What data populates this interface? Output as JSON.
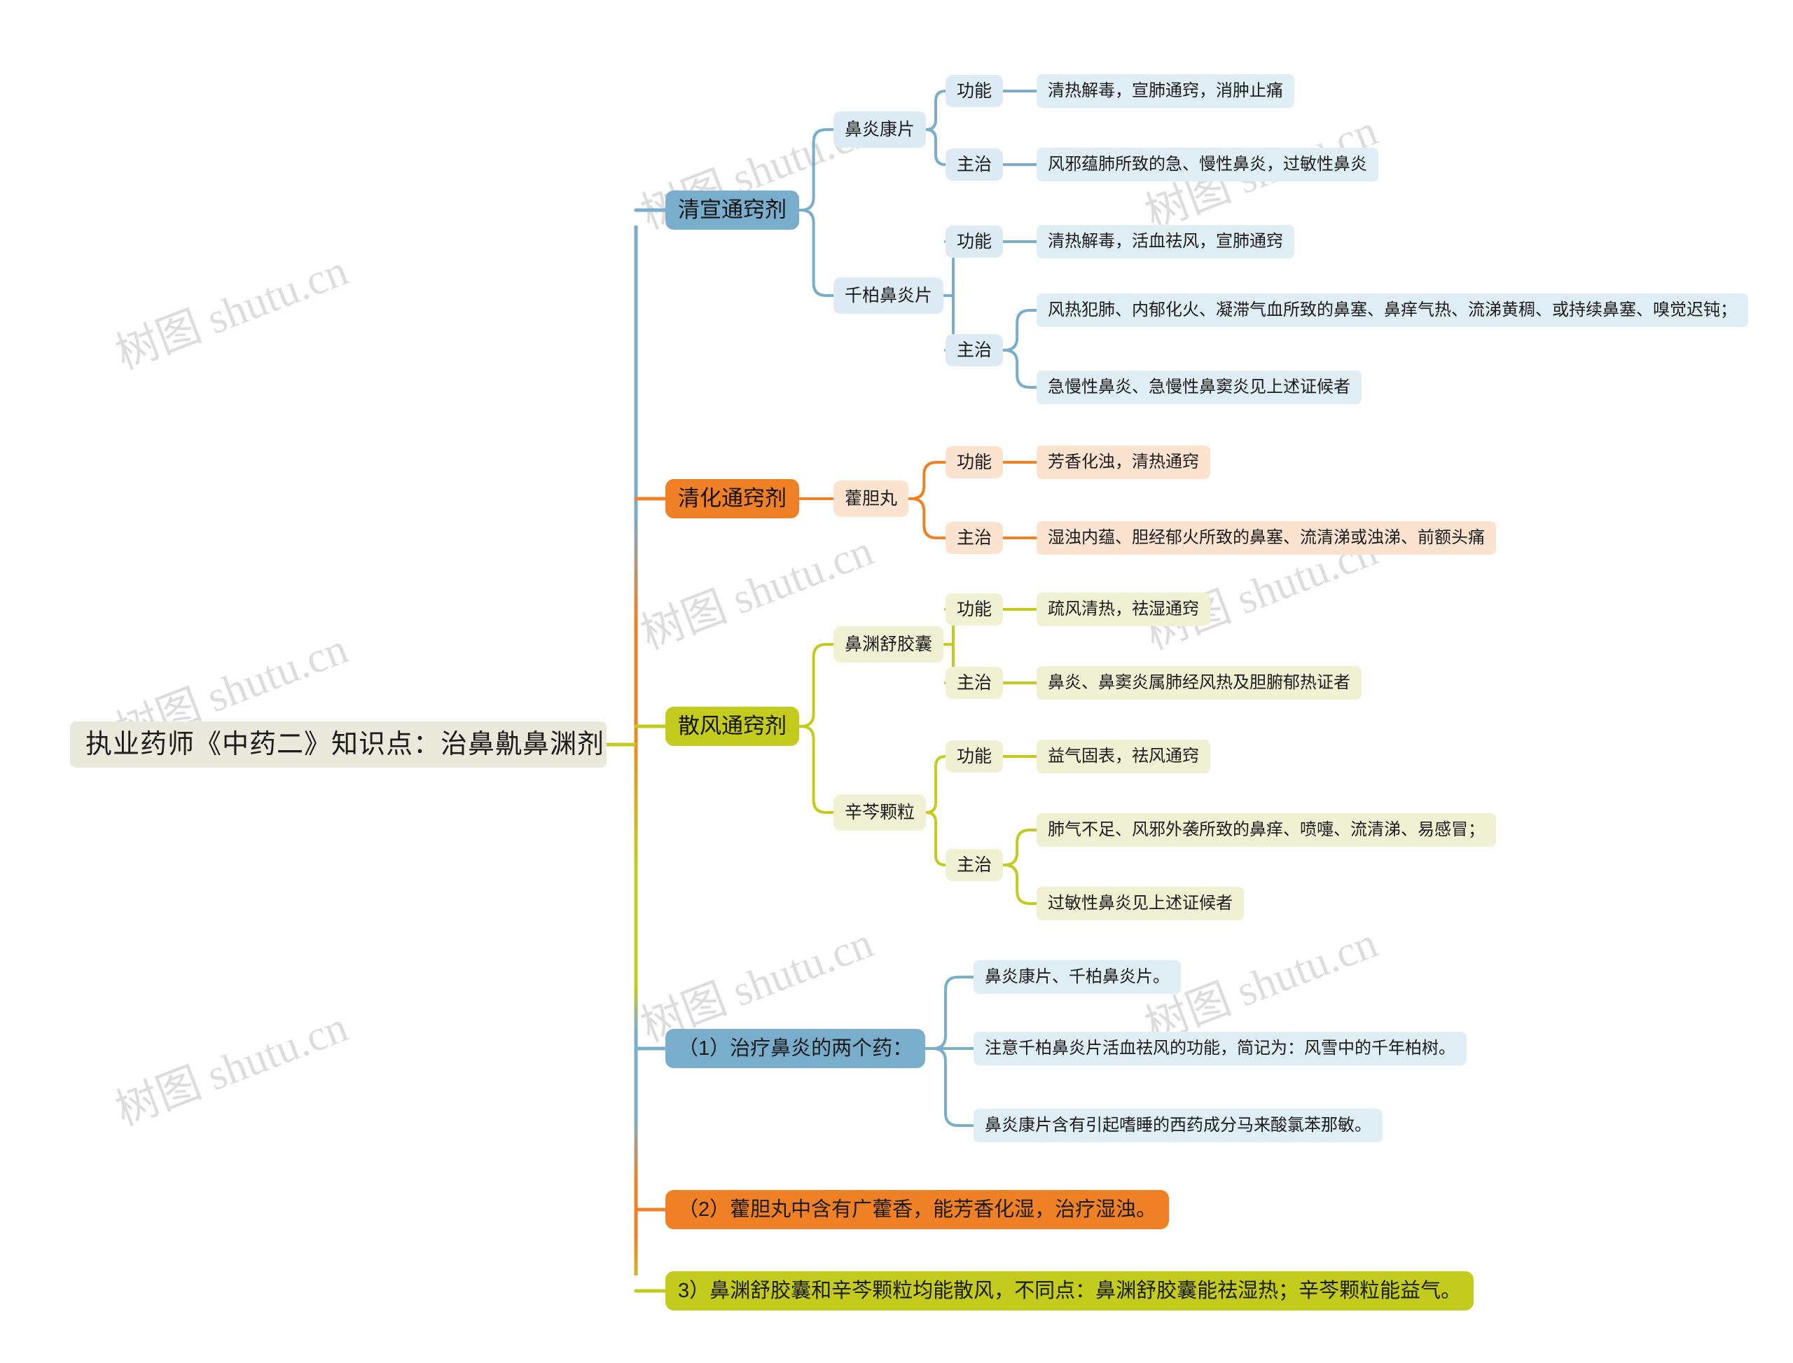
{
  "root": {
    "label": "执业药师《中药二》知识点：治鼻鼽鼻渊剂"
  },
  "watermark": {
    "text": "树图 shutu.cn"
  },
  "labels": {
    "gongneng": "功能",
    "zhuzhi": "主治"
  },
  "branches": [
    {
      "id": "qingxuan",
      "label": "清宣通窍剂",
      "color": "#78AECB",
      "drugs": [
        {
          "name": "鼻炎康片",
          "items": [
            {
              "label": "功能",
              "values": [
                "清热解毒，宣肺通窍，消肿止痛"
              ]
            },
            {
              "label": "主治",
              "values": [
                "风邪蕴肺所致的急、慢性鼻炎，过敏性鼻炎"
              ]
            }
          ]
        },
        {
          "name": "千柏鼻炎片",
          "items": [
            {
              "label": "功能",
              "values": [
                "清热解毒，活血祛风，宣肺通窍"
              ]
            },
            {
              "label": "主治",
              "values": [
                "风热犯肺、内郁化火、凝滞气血所致的鼻塞、鼻痒气热、流涕黄稠、或持续鼻塞、嗅觉迟钝；",
                "急慢性鼻炎、急慢性鼻窦炎见上述证候者"
              ]
            }
          ]
        }
      ]
    },
    {
      "id": "qinghua",
      "label": "清化通窍剂",
      "color": "#F08025",
      "drugs": [
        {
          "name": "藿胆丸",
          "items": [
            {
              "label": "功能",
              "values": [
                "芳香化浊，清热通窍"
              ]
            },
            {
              "label": "主治",
              "values": [
                "湿浊内蕴、胆经郁火所致的鼻塞、流清涕或浊涕、前额头痛"
              ]
            }
          ]
        }
      ]
    },
    {
      "id": "sanfeng",
      "label": "散风通窍剂",
      "color": "#C3CB1D",
      "drugs": [
        {
          "name": "鼻渊舒胶囊",
          "items": [
            {
              "label": "功能",
              "values": [
                "疏风清热，祛湿通窍"
              ]
            },
            {
              "label": "主治",
              "values": [
                "鼻炎、鼻窦炎属肺经风热及胆腑郁热证者"
              ]
            }
          ]
        },
        {
          "name": "辛芩颗粒",
          "items": [
            {
              "label": "功能",
              "values": [
                "益气固表，祛风通窍"
              ]
            },
            {
              "label": "主治",
              "values": [
                "肺气不足、风邪外袭所致的鼻痒、喷嚏、流清涕、易感冒；",
                "过敏性鼻炎见上述证候者"
              ]
            }
          ]
        }
      ]
    }
  ],
  "summaries": [
    {
      "id": "s1",
      "label": "（1）治疗鼻炎的两个药：",
      "color": "#78AECB",
      "children": [
        "鼻炎康片、千柏鼻炎片。",
        "注意千柏鼻炎片活血祛风的功能，简记为：风雪中的千年柏树。",
        "鼻炎康片含有引起嗜睡的西药成分马来酸氯苯那敏。"
      ]
    },
    {
      "id": "s2",
      "label": "（2）藿胆丸中含有广藿香，能芳香化湿，治疗湿浊。",
      "color": "#F08025",
      "children": []
    },
    {
      "id": "s3",
      "label": "3）鼻渊舒胶囊和辛芩颗粒均能散风，不同点：鼻渊舒胶囊能祛湿热；辛芩颗粒能益气。",
      "color": "#C3CB1D",
      "children": []
    }
  ],
  "palette": {
    "blue_strong": "#78AECB",
    "blue_soft": "#DCEBF4",
    "orange_strong": "#F08025",
    "orange_soft": "#FCE3D0",
    "green_strong": "#C3CB1D",
    "green_soft": "#EFF1D2",
    "root_bg": "#EAEADC",
    "watermark": "#DDDDDD"
  }
}
